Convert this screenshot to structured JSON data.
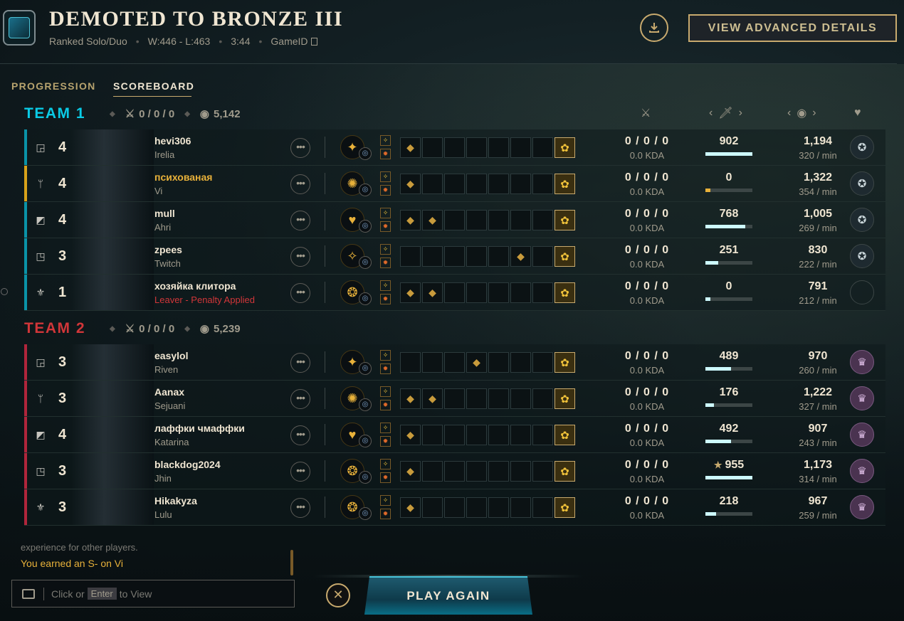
{
  "header": {
    "title": "DEMOTED TO BRONZE III",
    "queue": "Ranked Solo/Duo",
    "record": "W:446 - L:463",
    "duration": "3:44",
    "game_id_label": "GameID",
    "advanced_label": "VIEW ADVANCED DETAILS"
  },
  "tabs": [
    {
      "label": "PROGRESSION"
    },
    {
      "label": "SCOREBOARD",
      "active": true
    }
  ],
  "teams": [
    {
      "name": "TEAM 1",
      "kda": "0 / 0 / 0",
      "gold": "5,142",
      "accent": "#0acbe6",
      "players": [
        {
          "position": "top",
          "level": "4",
          "name": "hevi306",
          "champion": "Irelia",
          "kda": "0 / 0 / 0",
          "kda_ratio": "0.0 KDA",
          "damage": "902",
          "damage_fraction": 1.0,
          "gold": "1,194",
          "gold_per_min": "320 / min",
          "items": [
            "item",
            "",
            "",
            "",
            "",
            "",
            ""
          ],
          "honor": "honor-icon"
        },
        {
          "position": "jungle",
          "level": "4",
          "name": "психованая",
          "champion": "Vi",
          "kda": "0 / 0 / 0",
          "kda_ratio": "0.0 KDA",
          "damage": "0",
          "damage_fraction": 0.1,
          "gold": "1,322",
          "gold_per_min": "354 / min",
          "items": [
            "item",
            "",
            "",
            "",
            "",
            "",
            ""
          ],
          "honor": "honor-icon",
          "is_me": true
        },
        {
          "position": "mid",
          "level": "4",
          "name": "mull",
          "champion": "Ahri",
          "kda": "0 / 0 / 0",
          "kda_ratio": "0.0 KDA",
          "damage": "768",
          "damage_fraction": 0.85,
          "gold": "1,005",
          "gold_per_min": "269 / min",
          "items": [
            "item",
            "item",
            "",
            "",
            "",
            "",
            ""
          ],
          "honor": "honor-icon"
        },
        {
          "position": "bottom",
          "level": "3",
          "name": "zpees",
          "champion": "Twitch",
          "kda": "0 / 0 / 0",
          "kda_ratio": "0.0 KDA",
          "damage": "251",
          "damage_fraction": 0.28,
          "gold": "830",
          "gold_per_min": "222 / min",
          "items": [
            "",
            "",
            "",
            "",
            "",
            "item",
            ""
          ],
          "honor": "honor-icon"
        },
        {
          "position": "support",
          "level": "1",
          "name": "хозяйка клитора",
          "champion": "Leaver - Penalty Applied",
          "kda": "0 / 0 / 0",
          "kda_ratio": "0.0 KDA",
          "damage": "0",
          "damage_fraction": 0.1,
          "gold": "791",
          "gold_per_min": "212 / min",
          "items": [
            "item",
            "item",
            "",
            "",
            "",
            "",
            ""
          ],
          "honor": "",
          "leaver": true
        }
      ]
    },
    {
      "name": "TEAM 2",
      "kda": "0 / 0 / 0",
      "gold": "5,239",
      "accent": "#d13639",
      "players": [
        {
          "position": "top",
          "level": "3",
          "name": "easylol",
          "champion": "Riven",
          "kda": "0 / 0 / 0",
          "kda_ratio": "0.0 KDA",
          "damage": "489",
          "damage_fraction": 0.54,
          "gold": "970",
          "gold_per_min": "260 / min",
          "items": [
            "",
            "",
            "",
            "item",
            "",
            "",
            ""
          ],
          "honor": "honor-icon"
        },
        {
          "position": "jungle",
          "level": "3",
          "name": "Aanax",
          "champion": "Sejuani",
          "kda": "0 / 0 / 0",
          "kda_ratio": "0.0 KDA",
          "damage": "176",
          "damage_fraction": 0.18,
          "gold": "1,222",
          "gold_per_min": "327 / min",
          "items": [
            "item",
            "item",
            "",
            "",
            "",
            "",
            ""
          ],
          "honor": "honor-icon"
        },
        {
          "position": "mid",
          "level": "4",
          "name": "лаффки чмаффки",
          "champion": "Katarina",
          "kda": "0 / 0 / 0",
          "kda_ratio": "0.0 KDA",
          "damage": "492",
          "damage_fraction": 0.54,
          "gold": "907",
          "gold_per_min": "243 / min",
          "items": [
            "item",
            "",
            "",
            "",
            "",
            "",
            ""
          ],
          "honor": "honor-icon"
        },
        {
          "position": "bottom",
          "level": "3",
          "name": "blackdog2024",
          "champion": "Jhin",
          "kda": "0 / 0 / 0",
          "kda_ratio": "0.0 KDA",
          "damage": "955",
          "damage_fraction": 1.0,
          "damage_star": "★",
          "gold": "1,173",
          "gold_per_min": "314 / min",
          "items": [
            "item",
            "",
            "",
            "",
            "",
            "",
            ""
          ],
          "honor": "honor-icon"
        },
        {
          "position": "support",
          "level": "3",
          "name": "Hikakyza",
          "champion": "Lulu",
          "kda": "0 / 0 / 0",
          "kda_ratio": "0.0 KDA",
          "damage": "218",
          "damage_fraction": 0.22,
          "gold": "967",
          "gold_per_min": "259 / min",
          "items": [
            "item",
            "",
            "",
            "",
            "",
            "",
            ""
          ],
          "honor": "honor-icon"
        }
      ]
    }
  ],
  "chat": {
    "line1": "experience for other players.",
    "line2": "You earned an S- on Vi",
    "placeholder_prefix": "Click or",
    "key": "Enter",
    "placeholder_suffix": "to View"
  },
  "play_again_label": "PLAY AGAIN",
  "colors": {
    "gold": "#c8aa6e",
    "team1": "#0acbe6",
    "team2": "#d13639",
    "me": "#e8b13a"
  }
}
